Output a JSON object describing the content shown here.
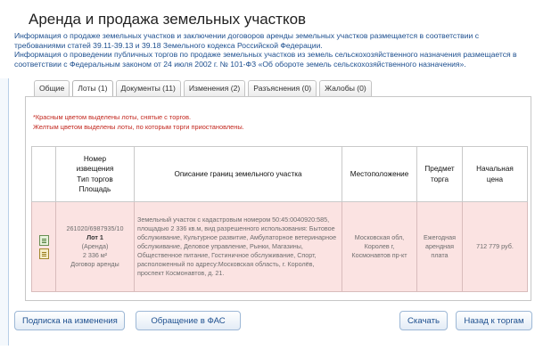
{
  "page": {
    "title": "Аренда и продажа земельных участков",
    "intro": [
      "Информация о продаже земельных участков и заключении договоров аренды земельных участков размещается в соответствии с требованиями статей 39.11-39.13 и 39.18 Земельного кодекса Российской Федерации.",
      "Информация о проведении публичных торгов по продаже земельных участков из земель сельскохозяйственного назначения размещается в соответствии с Федеральным законом от 24 июля 2002 г. № 101-ФЗ «Об обороте земель сельскохозяйственного назначения»."
    ]
  },
  "tabs": [
    {
      "label": "Общие"
    },
    {
      "label": "Лоты (1)",
      "active": true
    },
    {
      "label": "Документы (11)"
    },
    {
      "label": "Изменения (2)"
    },
    {
      "label": "Разъяснения (0)"
    },
    {
      "label": "Жалобы (0)"
    }
  ],
  "notes": {
    "red": "*Красным цветом выделены лоты, снятые с торгов.",
    "yellow": "Желтым цветом выделены лоты, по которым торги приостановлены."
  },
  "table": {
    "headers": {
      "notice_line1": "Номер",
      "notice_line2": "извещения",
      "notice_line3": "Тип торгов",
      "notice_line4": "Площадь",
      "description": "Описание границ земельного участка",
      "location": "Местоположение",
      "subject_line1": "Предмет",
      "subject_line2": "торга",
      "price_line1": "Начальная",
      "price_line2": "цена"
    },
    "row": {
      "notice_number": "261020/6987935/10",
      "lot": "Лот 1",
      "auction_type": "(Аренда)",
      "area": "2 336 м²",
      "contract": "Договор аренды",
      "description": "Земельный участок с кадастровым номером 50:45:0040920:585, площадью 2 336 кв.м, вид разрешенного использования: Бытовое обслуживание, Культурное развитие, Амбулаторное ветеринарное обслуживание, Деловое управление, Рынки, Магазины, Общественное питание, Гостиничное обслуживание, Спорт, расположенный по адресу:Московская область, г. Королёв, проспект Космонавтов, д. 21.",
      "location": "Московская обл, Королев г, Космонавтов пр-кт",
      "subject": "Ежегодная арендная плата",
      "price": "712 779 руб."
    }
  },
  "buttons": {
    "subscribe": "Подписка на изменения",
    "fas": "Обращение в ФАС",
    "download": "Скачать",
    "back": "Назад к торгам"
  },
  "colors": {
    "link_blue": "#1d4f8f",
    "removed_lot_bg": "#fbe3e2",
    "note_red": "#c2261d"
  }
}
